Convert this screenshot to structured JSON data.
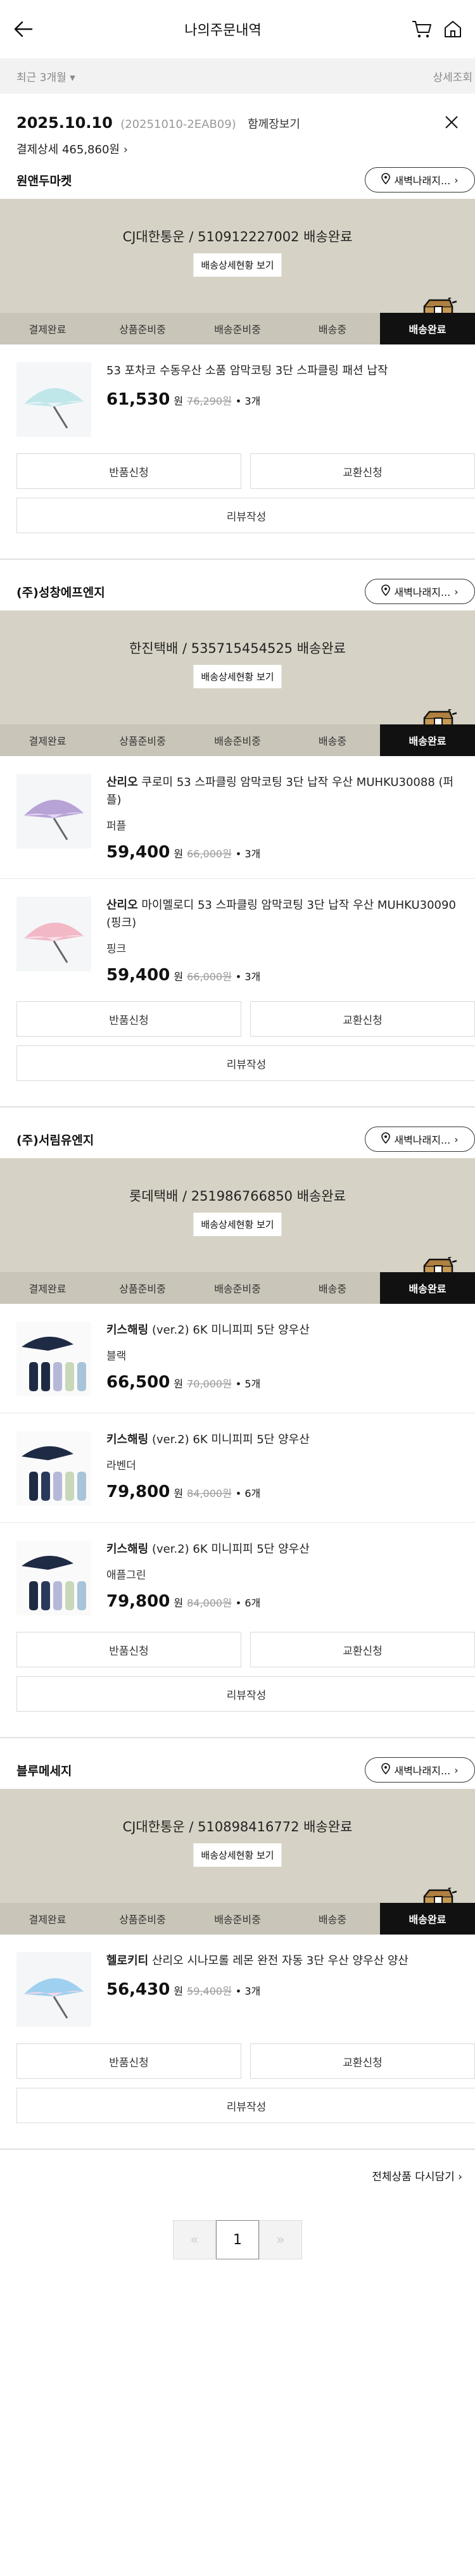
{
  "header": {
    "title": "나의주문내역"
  },
  "filter": {
    "period": "최근 3개월",
    "detail_search": "상세조회"
  },
  "order": {
    "date": "2025.10.10",
    "order_no": "(20251010-2EAB09)",
    "together": "함께장보기",
    "pay_detail": "결제상세 465,860원"
  },
  "step_labels": [
    "결제완료",
    "상품준비중",
    "배송준비중",
    "배송중",
    "배송완료"
  ],
  "track_detail_btn": "배송상세현황 보기",
  "buttons": {
    "return": "반품신청",
    "exchange": "교환신청",
    "review": "리뷰작성"
  },
  "sellers": [
    {
      "name": "원앤두마켓",
      "pill": "새벽나래지...",
      "courier": "CJ대한통운 / 510912227002 배송완료",
      "items": [
        {
          "brand": "",
          "name": "53 포차코 수동우산 소품 암막코팅 3단 스파클링 패션 납작",
          "option": "",
          "price": "61,530",
          "won": "원",
          "was": "76,290원",
          "qty": "• 3개"
        }
      ]
    },
    {
      "name": "(주)성창에프엔지",
      "pill": "새벽나래지...",
      "courier": "한진택배 / 535715454525 배송완료",
      "items": [
        {
          "brand": "산리오",
          "name": "쿠로미 53 스파클링 암막코팅 3단 납작 우산 MUHKU30088 (퍼플)",
          "option": "퍼플",
          "price": "59,400",
          "won": "원",
          "was": "66,000원",
          "qty": "• 3개"
        },
        {
          "brand": "산리오",
          "name": "마이멜로디 53 스파클링 암막코팅 3단 납작 우산 MUHKU30090 (핑크)",
          "option": "핑크",
          "price": "59,400",
          "won": "원",
          "was": "66,000원",
          "qty": "• 3개"
        }
      ]
    },
    {
      "name": "(주)서림유엔지",
      "pill": "새벽나래지...",
      "courier": "롯데택배 / 251986766850 배송완료",
      "items": [
        {
          "brand": "키스해링",
          "name": "(ver.2) 6K 미니피피 5단 양우산",
          "option": "블랙",
          "price": "66,500",
          "won": "원",
          "was": "70,000원",
          "qty": "• 5개"
        },
        {
          "brand": "키스해링",
          "name": "(ver.2) 6K 미니피피 5단 양우산",
          "option": "라벤더",
          "price": "79,800",
          "won": "원",
          "was": "84,000원",
          "qty": "• 6개"
        },
        {
          "brand": "키스해링",
          "name": "(ver.2) 6K 미니피피 5단 양우산",
          "option": "애플그린",
          "price": "79,800",
          "won": "원",
          "was": "84,000원",
          "qty": "• 6개"
        }
      ]
    },
    {
      "name": "블루메세지",
      "pill": "새벽나래지...",
      "courier": "CJ대한통운 / 510898416772 배송완료",
      "items": [
        {
          "brand": "헬로키티",
          "name": "산리오 시나모롤 레몬 완전 자동 3단 우산 양우산 양산",
          "option": "",
          "price": "56,430",
          "won": "원",
          "was": "59,400원",
          "qty": "• 3개"
        }
      ]
    }
  ],
  "reorder": "전체상품 다시담기 ›",
  "pager": {
    "prev": "«",
    "current": "1",
    "next": "»"
  },
  "colors": {
    "track_bg": "#d6d2c5",
    "steps_bg": "#c9c5b8",
    "active_step": "#111111"
  }
}
